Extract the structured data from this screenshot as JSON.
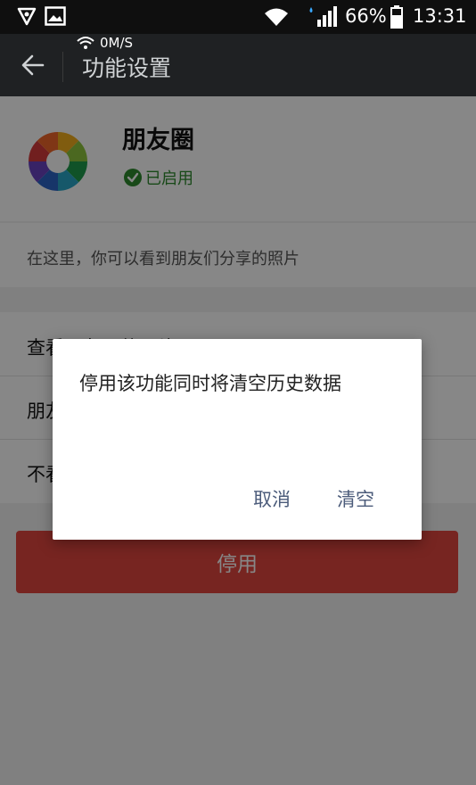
{
  "status_bar": {
    "network_speed": "0M/S",
    "battery": "66%",
    "time": "13:31",
    "icons": [
      "vpn-shield-icon",
      "gallery-icon",
      "wifi-icon",
      "signal-icon",
      "battery-icon"
    ]
  },
  "app_bar": {
    "title": "功能设置",
    "back_icon": "arrow-left-icon"
  },
  "plugin": {
    "name": "朋友圈",
    "status": "已启用",
    "description": "在这里，你可以看到朋友们分享的照片"
  },
  "list": {
    "items": [
      "查看朋友圈的照片",
      "朋友圈设置",
      "不看他(她)的朋友圈"
    ]
  },
  "disable_button": {
    "label": "停用"
  },
  "dialog": {
    "message": "停用该功能同时将清空历史数据",
    "cancel": "取消",
    "confirm": "清空"
  },
  "colors": {
    "status_green": "#2f8a2f",
    "disable_red": "#e0463f",
    "dialog_action": "#4b5b7a"
  }
}
